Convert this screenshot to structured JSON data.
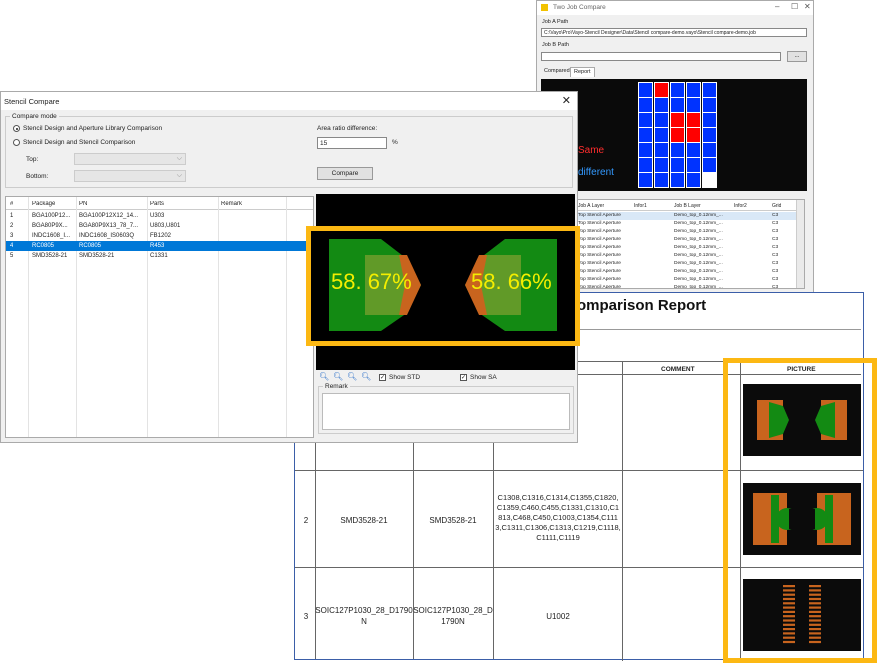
{
  "two_job": {
    "title": "Two Job Compare",
    "job_a_label": "Job A Path",
    "job_a_value": "C:\\Vayo\\Pro\\Vayo-Stencil Designer\\Data\\Stencil compare-demo.vayo\\Stencil compare-demo.job",
    "job_b_label": "Job B Path",
    "job_b_value": "",
    "browse_label": "...",
    "tabs": [
      "Compared",
      "Report"
    ],
    "legend_same": "Same",
    "legend_diff": "different",
    "grid_colors": {
      "same": "#ff0000",
      "diff": "#0033ff",
      "blank": "#ffffff"
    },
    "table_headers": [
      "Job A Layer",
      "Infor1",
      "Job B Layer",
      "Infor2",
      "Grid"
    ],
    "table_rows": [
      [
        "Top Stencil Aperture",
        "",
        "Demo_top_0.12mm_...",
        "",
        "C3"
      ],
      [
        "Top Stencil Aperture",
        "",
        "Demo_top_0.12mm_...",
        "",
        "C3"
      ],
      [
        "Top Stencil Aperture",
        "",
        "Demo_top_0.12mm_...",
        "",
        "C3"
      ],
      [
        "Top Stencil Aperture",
        "",
        "Demo_top_0.12mm_...",
        "",
        "C3"
      ],
      [
        "Top Stencil Aperture",
        "",
        "Demo_top_0.12mm_...",
        "",
        "C3"
      ],
      [
        "Top Stencil Aperture",
        "",
        "Demo_top_0.12mm_...",
        "",
        "C3"
      ],
      [
        "Top Stencil Aperture",
        "",
        "Demo_top_0.12mm_...",
        "",
        "C3"
      ],
      [
        "Top Stencil Aperture",
        "",
        "Demo_top_0.12mm_...",
        "",
        "C3"
      ],
      [
        "Top Stencil Aperture",
        "",
        "Demo_top_0.12mm_...",
        "",
        "C3"
      ],
      [
        "Top Stencil Aperture",
        "",
        "Demo_top_0.12mm_...",
        "",
        "C3"
      ]
    ]
  },
  "report": {
    "title": "omparison Report",
    "col_comment": "COMMENT",
    "col_picture": "PICTURE",
    "rows": [
      {
        "no": "2",
        "pkg": "SMD3528-21",
        "pn": "SMD3528-21",
        "parts": "C1308,C1316,C1314,C1355,C1820,C1359,C460,C455,C1331,C1310,C1813,C468,C450,C1003,C1354,C1113,C1311,C1306,C1313,C1219,C1118,C1111,C1119"
      },
      {
        "no": "3",
        "pkg": "SOIC127P1030_28_D1790N",
        "pn": "SOIC127P1030_28_D1790N",
        "parts": "U1002"
      }
    ]
  },
  "stencil": {
    "title": "Stencil Compare",
    "close_glyph": "✕",
    "compare_mode_label": "Compare mode",
    "radio1": "Stencil Design and Aperture Library Comparison",
    "radio2": "Stencil Design and Stencil Comparison",
    "top_label": "Top:",
    "bottom_label": "Bottom:",
    "area_ratio_label": "Area ratio difference:",
    "area_ratio_value": "15",
    "percent_unit": "%",
    "compare_button": "Compare",
    "list_headers": [
      "#",
      "Package",
      "PN",
      "Parts",
      "Remark"
    ],
    "list_rows": [
      [
        "1",
        "BGA100P12...",
        "BGA100P12X12_14...",
        "U303",
        ""
      ],
      [
        "2",
        "BGA80P9X...",
        "BGA80P9X13_78_7...",
        "U803,U801",
        ""
      ],
      [
        "3",
        "INDC1608_I...",
        "INDC1608_IS0603Q",
        "FB1202",
        ""
      ],
      [
        "4",
        "RC0805",
        "RC0805",
        "R453",
        ""
      ],
      [
        "5",
        "SMD3528-21",
        "SMD3528-21",
        "C1331",
        ""
      ]
    ],
    "selected_row": 3,
    "show_std": "Show STD",
    "show_sa": "Show SA",
    "remark_label": "Remark"
  },
  "zoom": {
    "left_pct": "58. 67%",
    "right_pct": "58. 66%"
  },
  "colors": {
    "highlight": "#fcb813",
    "pad_green": "#138a13",
    "pad_orange": "#c8641e",
    "selection": "#0078d7"
  }
}
